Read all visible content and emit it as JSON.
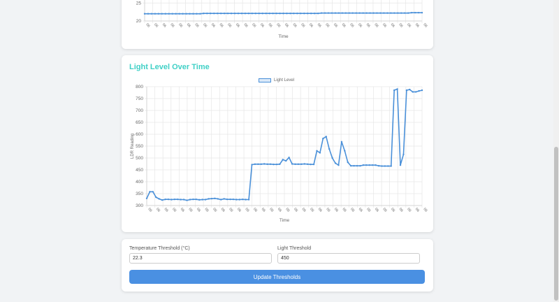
{
  "temperature_chart": {
    "y_ticks": [
      "25",
      "20"
    ],
    "x_label": "Time",
    "x_tick": "06"
  },
  "light_chart": {
    "title": "Light Level Over Time",
    "legend": "Light Level",
    "y_label": "LDR Reading",
    "x_label": "Time",
    "x_tick": "06"
  },
  "thresholds": {
    "temp_label": "Temperature Threshold (°C)",
    "temp_value": "22.3",
    "light_label": "Light Threshold",
    "light_value": "450",
    "update_label": "Update Thresholds"
  },
  "colors": {
    "accent": "#4a90e2",
    "title": "#3fd0c6",
    "line": "#4a90d9"
  },
  "chart_data": [
    {
      "type": "line",
      "xlabel": "Time",
      "ylabel": "",
      "ylim": [
        20,
        27
      ],
      "y_ticks": [
        20,
        25
      ],
      "series": [
        {
          "values": [
            22.0,
            22.0,
            22.0,
            22.0,
            22.0,
            22.0,
            22.0,
            22.0,
            22.0,
            22.0,
            22.0,
            22.0,
            22.0,
            22.0,
            22.0,
            22.0,
            22.0,
            22.1,
            22.1,
            22.1,
            22.1,
            22.1,
            22.1,
            22.1,
            22.1,
            22.1,
            22.1,
            22.1,
            22.1,
            22.1,
            22.1,
            22.1,
            22.1,
            22.1,
            22.1,
            22.1,
            22.1,
            22.1,
            22.1,
            22.1,
            22.1,
            22.1,
            22.1,
            22.1,
            22.1,
            22.1,
            22.1,
            22.1,
            22.1,
            22.1,
            22.1,
            22.2,
            22.2,
            22.2,
            22.2,
            22.2,
            22.2,
            22.2,
            22.2,
            22.2,
            22.2,
            22.2,
            22.2,
            22.2,
            22.2,
            22.2,
            22.2,
            22.2,
            22.2,
            22.2,
            22.2,
            22.2,
            22.2,
            22.2,
            22.2,
            22.2,
            22.2,
            22.3,
            22.3,
            22.3,
            22.3
          ]
        }
      ]
    },
    {
      "type": "line",
      "title": "Light Level Over Time",
      "xlabel": "Time",
      "ylabel": "LDR Reading",
      "ylim": [
        300,
        800
      ],
      "y_ticks": [
        300,
        350,
        400,
        450,
        500,
        550,
        600,
        650,
        700,
        750,
        800
      ],
      "series": [
        {
          "name": "Light Level",
          "values": [
            330,
            358,
            358,
            335,
            328,
            323,
            326,
            326,
            325,
            326,
            326,
            325,
            325,
            322,
            325,
            326,
            326,
            324,
            325,
            325,
            328,
            329,
            330,
            328,
            325,
            328,
            326,
            326,
            326,
            325,
            325,
            326,
            325,
            325,
            472,
            474,
            474,
            474,
            475,
            474,
            474,
            473,
            473,
            474,
            493,
            488,
            502,
            475,
            474,
            474,
            474,
            475,
            474,
            473,
            473,
            530,
            522,
            582,
            590,
            538,
            500,
            478,
            470,
            568,
            530,
            482,
            467,
            467,
            467,
            467,
            470,
            470,
            470,
            470,
            470,
            467,
            466,
            466,
            466,
            466,
            785,
            790,
            470,
            515,
            785,
            788,
            778,
            778,
            782,
            785
          ]
        }
      ]
    }
  ]
}
